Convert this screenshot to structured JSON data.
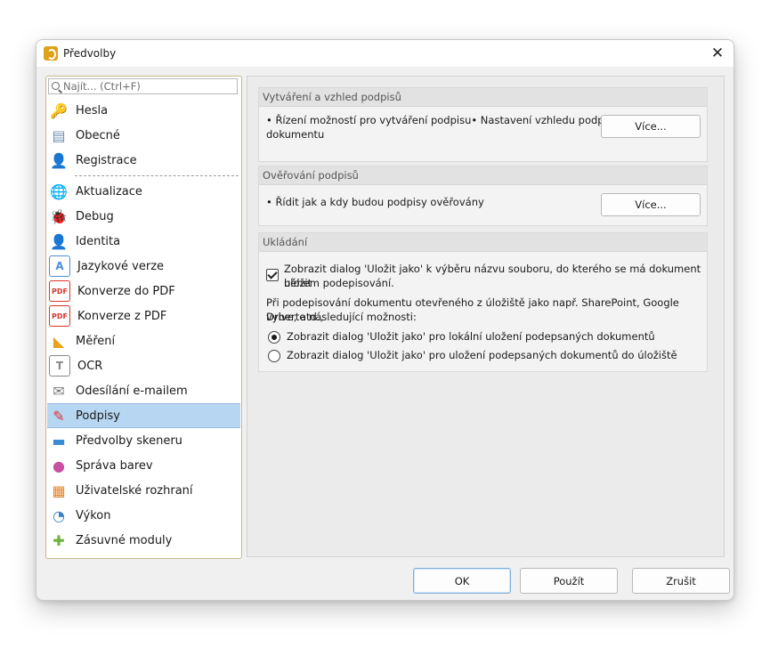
{
  "window": {
    "title": "Předvolby",
    "close_glyph": "✕"
  },
  "search": {
    "placeholder": "Najít... (Ctrl+F)"
  },
  "sidebar": {
    "items": [
      {
        "label": "Hesla",
        "icon": "key-icon",
        "glyph": "🔑",
        "color": "#f3c21a"
      },
      {
        "label": "Obecné",
        "icon": "general-settings-icon",
        "glyph": "▤",
        "color": "#6f8fb5"
      },
      {
        "label": "Registrace",
        "icon": "registration-icon",
        "glyph": "👤",
        "color": "#3ea84a"
      },
      {
        "label": "Aktualizace",
        "icon": "globe-icon",
        "glyph": "🌐",
        "color": "#3d8fd1"
      },
      {
        "label": "Debug",
        "icon": "bug-icon",
        "glyph": "🐞",
        "color": "#5aa540"
      },
      {
        "label": "Identita",
        "icon": "identity-icon",
        "glyph": "👤",
        "color": "#e59a3d"
      },
      {
        "label": "Jazykové verze",
        "icon": "language-icon",
        "glyph": "A",
        "color": "#4a90d9"
      },
      {
        "label": "Konverze do PDF",
        "icon": "convert-to-pdf-icon",
        "glyph": "PDF",
        "color": "#d9342b"
      },
      {
        "label": "Konverze z PDF",
        "icon": "convert-from-pdf-icon",
        "glyph": "PDF",
        "color": "#d9342b"
      },
      {
        "label": "Měření",
        "icon": "ruler-icon",
        "glyph": "◣",
        "color": "#e8a21c"
      },
      {
        "label": "OCR",
        "icon": "ocr-icon",
        "glyph": "T",
        "color": "#888888"
      },
      {
        "label": "Odesílání e-mailem",
        "icon": "envelope-icon",
        "glyph": "✉",
        "color": "#7a7a7a"
      },
      {
        "label": "Podpisy",
        "icon": "signature-icon",
        "glyph": "✎",
        "color": "#d9342b"
      },
      {
        "label": "Předvolby skeneru",
        "icon": "scanner-icon",
        "glyph": "▬",
        "color": "#3b8ad6"
      },
      {
        "label": "Správa barev",
        "icon": "color-wheel-icon",
        "glyph": "●",
        "color": "#c94fa0"
      },
      {
        "label": "Uživatelské rozhraní",
        "icon": "user-interface-icon",
        "glyph": "▦",
        "color": "#e3801f"
      },
      {
        "label": "Výkon",
        "icon": "gauge-icon",
        "glyph": "◔",
        "color": "#3b7fc6"
      },
      {
        "label": "Zásuvné moduly",
        "icon": "puzzle-icon",
        "glyph": "✚",
        "color": "#6cb33f"
      }
    ]
  },
  "groups": {
    "create": {
      "title": "Vytváření a vzhled podpisů",
      "line1": "• Řízení možností pro vytváření podpisu• Nastavení vzhledu podpisů v",
      "line2": "dokumentu",
      "button": "Více..."
    },
    "verify": {
      "title": "Ověřování podpisů",
      "line1": "• Řídit jak a kdy budou podpisy ověřovány",
      "button": "Více..."
    },
    "save": {
      "title": "Ukládání",
      "checkbox_line1": "Zobrazit dialog 'Uložit jako' k výběru názvu souboru, do kterého se má dokument uložit",
      "checkbox_line2": "během podepisování.",
      "info_line1": "Při podepisování dokumentu otevřeného z úložiště jako např. SharePoint, Google Drive, atd.,",
      "info_line2": "vyberte následující možnosti:",
      "radio1": "Zobrazit dialog 'Uložit jako' pro lokální uložení podepsaných dokumentů",
      "radio2": "Zobrazit dialog 'Uložit jako' pro uložení podepsaných dokumentů do úložiště"
    }
  },
  "footer": {
    "ok": "OK",
    "apply": "Použít",
    "cancel": "Zrušit"
  },
  "colors": {
    "selection": "#b7d6f1",
    "accent": "#7fb0dd"
  }
}
